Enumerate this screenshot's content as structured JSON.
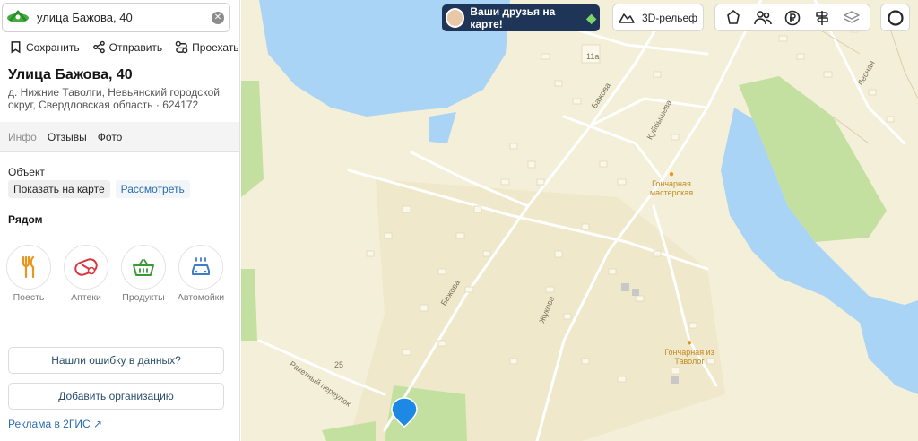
{
  "search": {
    "value": "улица Бажова, 40"
  },
  "actions": {
    "save": "Сохранить",
    "share": "Отправить",
    "route": "Проехать"
  },
  "place": {
    "title": "Улица Бажова, 40",
    "address": "д. Нижние Таволги, Невьянский городской округ, Свердловская область · 624172"
  },
  "tabs": [
    "Инфо",
    "Отзывы",
    "Фото"
  ],
  "object": {
    "label": "Объект",
    "show_on_map": "Показать на карте",
    "view": "Рассмотреть"
  },
  "nearby": {
    "label": "Рядом",
    "items": [
      {
        "label": "Поесть",
        "icon": "fork-knife-icon"
      },
      {
        "label": "Аптеки",
        "icon": "pharmacy-icon"
      },
      {
        "label": "Продукты",
        "icon": "basket-icon"
      },
      {
        "label": "Автомойки",
        "icon": "car-wash-icon"
      }
    ]
  },
  "buttons": {
    "report_error": "Нашли ошибку в данных?",
    "add_org": "Добавить организацию"
  },
  "ad": "Реклама в 2ГИС ↗",
  "map": {
    "promo": "Ваши друзья на карте!",
    "relief": "3D-рельеф",
    "labels": {
      "bazhova_1": "Бажова",
      "bazhova_2": "Бажова",
      "kuybysheva": "Куйбышева",
      "zhukova": "Жукова",
      "rakety": "Ракетный переулок",
      "lesnaya": "Лесная",
      "house_11a": "11а",
      "house_25": "25",
      "poi_1": "Гончарная мастерская",
      "poi_2": "Гончарная из Таволог"
    }
  },
  "colors": {
    "accent": "#2a6eb3",
    "water": "#a9d4f5",
    "park": "#c3e0a0",
    "land": "#f4efd8",
    "pin": "#1e88e5"
  }
}
